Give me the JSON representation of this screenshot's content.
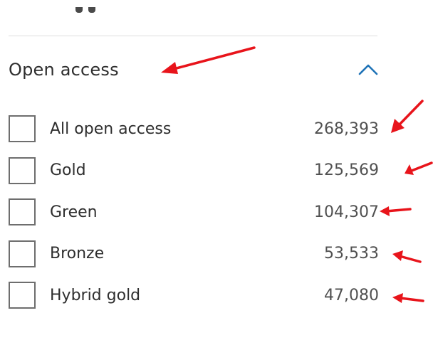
{
  "section": {
    "title": "Open access",
    "collapse_icon": "chevron-up-icon"
  },
  "filters": [
    {
      "label": "All open access",
      "count": "268,393",
      "checked": false
    },
    {
      "label": "Gold",
      "count": "125,569",
      "checked": false
    },
    {
      "label": "Green",
      "count": "104,307",
      "checked": false
    },
    {
      "label": "Bronze",
      "count": "53,533",
      "checked": false
    },
    {
      "label": "Hybrid gold",
      "count": "47,080",
      "checked": false
    }
  ],
  "colors": {
    "accent": "#1f73b7",
    "annotation": "#e8141b",
    "text": "#2e2e2e",
    "count_text": "#505050",
    "checkbox_border": "#6e6e6e",
    "divider": "#dcdcdc"
  }
}
